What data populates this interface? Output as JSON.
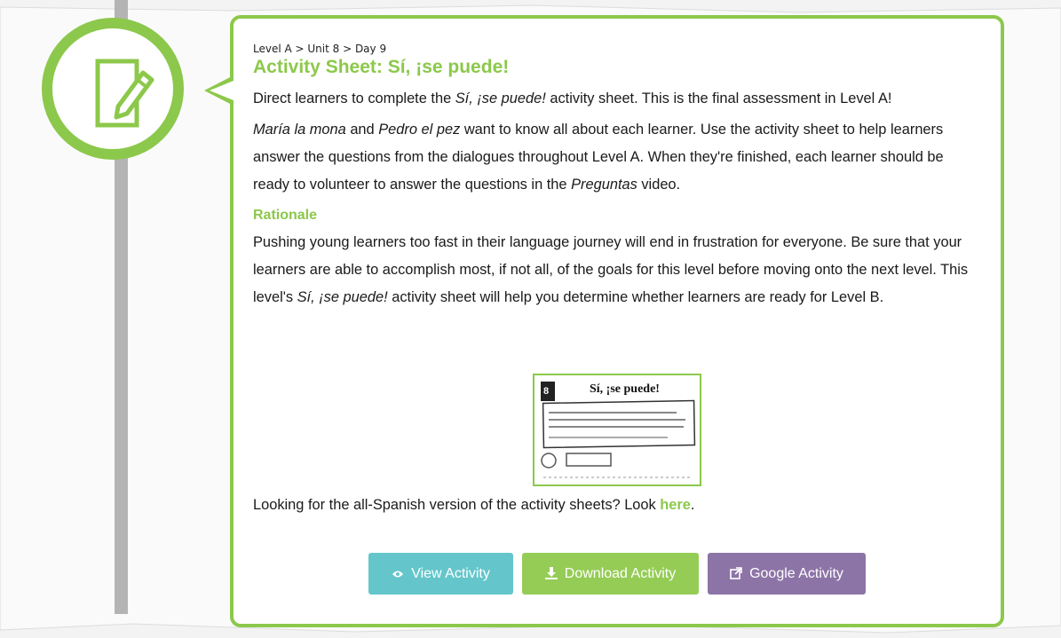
{
  "breadcrumb": "Level A > Unit 8 > Day 9",
  "title": "Activity Sheet: Sí, ¡se puede!",
  "intro": {
    "pre": "Direct learners to complete the ",
    "em": "Sí, ¡se puede!",
    "post": " activity sheet. This is the final assessment in Level A!"
  },
  "para2": {
    "em1": "María la mona",
    "t1": " and ",
    "em2": "Pedro el pez",
    "t2": " want to know all about each learner. Use the activity sheet to help learners answer the questions from the dialogues throughout Level A. When they're finished, each learner should be ready to volunteer to answer the questions in the ",
    "em3": "Preguntas",
    "t3": " video."
  },
  "rationale_heading": "Rationale",
  "rationale": {
    "t1": "Pushing young learners too fast in their language journey will end in frustration for everyone. Be sure that your learners are able to accomplish most, if not all, of the goals for this level before moving onto the next level. This level's ",
    "em": "Sí, ¡se puede!",
    "t2": " activity sheet will help you determine whether learners are ready for Level B."
  },
  "thumbnail": {
    "title": "Sí, ¡se puede!",
    "level_badge": "8"
  },
  "spanish_note": {
    "text": "Looking for the all-Spanish version of the activity sheets? Look ",
    "link": "here",
    "end": "."
  },
  "buttons": {
    "view": "View Activity",
    "download": "Download Activity",
    "google": "Google Activity"
  },
  "icons": {
    "circle": "edit-document-icon",
    "view": "eye-icon",
    "download": "download-icon",
    "google": "external-link-icon"
  },
  "colors": {
    "accent_green": "#8cc84b",
    "view_button": "#64c6cb",
    "download_button": "#95cc55",
    "google_button": "#8d74a7",
    "timeline": "#b4b4b4"
  }
}
